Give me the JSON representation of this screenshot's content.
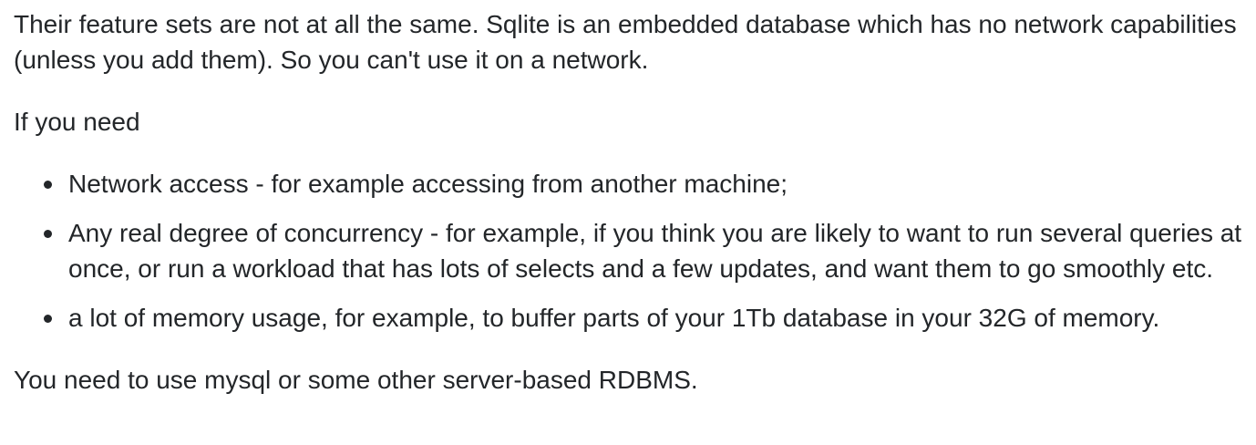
{
  "answer": {
    "intro": "Their feature sets are not at all the same. Sqlite is an embedded database which has no network capabilities (unless you add them). So you can't use it on a network.",
    "if_you_need": "If you need",
    "needs": [
      "Network access - for example accessing from another machine;",
      "Any real degree of concurrency - for example, if you think you are likely to want to run several queries at once, or run a workload that has lots of selects and a few updates, and want them to go smoothly etc.",
      "a lot of memory usage, for example, to buffer parts of your 1Tb database in your 32G of memory."
    ],
    "conclusion": "You need to use mysql or some other server-based RDBMS."
  }
}
